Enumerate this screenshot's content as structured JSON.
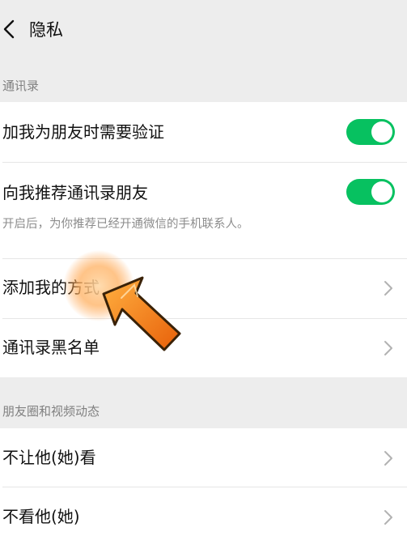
{
  "header": {
    "title": "隐私",
    "back_icon": "chevron-left-icon"
  },
  "contacts_section": {
    "label": "通讯录",
    "rows": [
      {
        "label": "加我为朋友时需要验证",
        "control": "toggle",
        "toggle_on": true
      },
      {
        "label": "向我推荐通讯录朋友",
        "control": "toggle",
        "toggle_on": true,
        "description": "开启后，为你推荐已经开通微信的手机联系人。"
      },
      {
        "label": "添加我的方式",
        "control": "chevron"
      },
      {
        "label": "通讯录黑名单",
        "control": "chevron"
      }
    ]
  },
  "moments_section": {
    "label": "朋友圈和视频动态",
    "rows": [
      {
        "label": "不让他(她)看",
        "control": "chevron"
      },
      {
        "label": "不看他(她)",
        "control": "chevron"
      }
    ]
  },
  "overlay": {
    "pointer": "orange-arrow-pointer-icon",
    "highlight": "tap-highlight-icon"
  },
  "colors": {
    "background": "#ededed",
    "card": "#ffffff",
    "toggle_on": "#07c160",
    "section_text": "#808080",
    "pointer_orange": "#f07a10"
  }
}
